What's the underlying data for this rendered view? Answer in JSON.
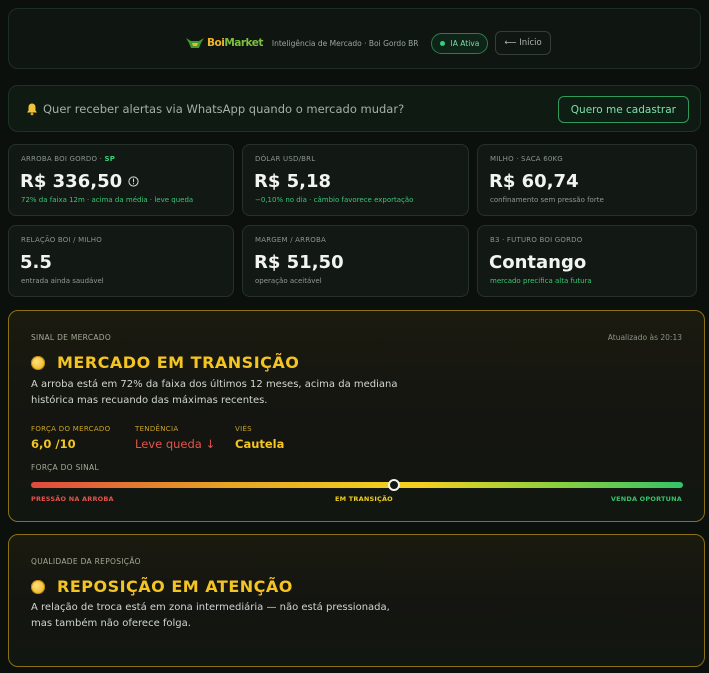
{
  "header": {
    "logo_part1": "Boi",
    "logo_part2": "Market",
    "subtitle": "Inteligência de Mercado · Boi Gordo BR",
    "ia_badge": "IA Ativa",
    "inicio_button": "⟵ Início"
  },
  "alert": {
    "text": "Quer receber alertas via WhatsApp quando o mercado mudar?",
    "cta": "Quero me cadastrar"
  },
  "cards": [
    {
      "label": "ARROBA BOI GORDO · ",
      "label_tag": "SP",
      "value": "R$ 336,50",
      "note": "72% da faixa 12m · acima da média · leve queda",
      "note_color": "green"
    },
    {
      "label": "DÓLAR USD/BRL",
      "value": "R$ 5,18",
      "note": "−0,10% no dia · câmbio favorece exportação",
      "note_color": "green"
    },
    {
      "label": "MILHO · SACA 60KG",
      "value": "R$ 60,74",
      "note": "confinamento sem pressão forte",
      "note_color": "gray"
    },
    {
      "label": "RELAÇÃO BOI / MILHO",
      "value": "5.5",
      "note": "entrada ainda saudável",
      "note_color": "gray"
    },
    {
      "label": "MARGEM / ARROBA",
      "value": "R$ 51,50",
      "note": "operação aceitável",
      "note_color": "gray"
    },
    {
      "label": "B3 · FUTURO BOI GORDO",
      "value": "Contango",
      "note": "mercado precifica alta futura",
      "note_color": "green"
    }
  ],
  "signal": {
    "section": "SINAL DE MERCADO",
    "updated": "Atualizado às 20:13",
    "title": "MERCADO EM TRANSIÇÃO",
    "description": "A arroba está em 72% da faixa dos últimos 12 meses, acima da mediana histórica mas recuando das máximas recentes.",
    "metrics": [
      {
        "key": "FORÇA DO MERCADO",
        "value": "6,0 /10",
        "color": "#f4c423"
      },
      {
        "key": "TENDÊNCIA",
        "value": "Leve queda ↓",
        "color": "#e5534b"
      },
      {
        "key": "VIÉS",
        "value": "Cautela",
        "color": "#f4c423"
      }
    ],
    "strength_label": "FORÇA DO SINAL",
    "strength_value": 0.557,
    "bar_left": "PRESSÃO NA ARROBA",
    "bar_mid": "EM TRANSIÇÃO",
    "bar_right": "VENDA OPORTUNA",
    "colors": {
      "left": "#e0493f",
      "mid": "#f0cf1d",
      "right": "#34c368"
    }
  },
  "quality": {
    "section": "QUALIDADE DA REPOSIÇÃO",
    "title": "REPOSIÇÃO EM ATENÇÃO",
    "description": "A relação de troca está em zona intermediária — não está pressionada, mas também não oferece folga."
  }
}
